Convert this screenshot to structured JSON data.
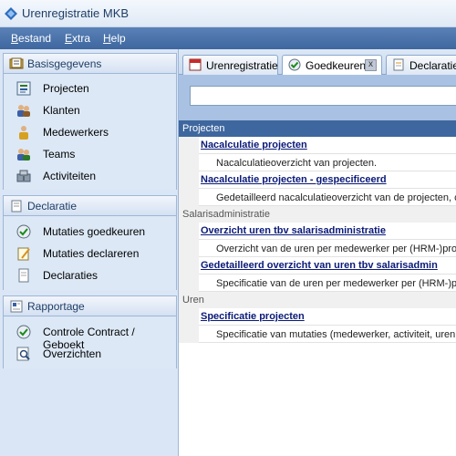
{
  "window": {
    "title": "Urenregistratie MKB"
  },
  "menubar": {
    "items": [
      {
        "label": "Bestand",
        "underline": "B"
      },
      {
        "label": "Extra",
        "underline": "E"
      },
      {
        "label": "Help",
        "underline": "H"
      }
    ]
  },
  "sidebar": {
    "groups": [
      {
        "label": "Basisgegevens",
        "items": [
          {
            "label": "Projecten"
          },
          {
            "label": "Klanten"
          },
          {
            "label": "Medewerkers"
          },
          {
            "label": "Teams"
          },
          {
            "label": "Activiteiten"
          }
        ]
      },
      {
        "label": "Declaratie",
        "items": [
          {
            "label": "Mutaties goedkeuren"
          },
          {
            "label": "Mutaties declareren"
          },
          {
            "label": "Declaraties"
          }
        ]
      },
      {
        "label": "Rapportage",
        "items": [
          {
            "label": "Controle Contract / Geboekt"
          },
          {
            "label": "Overzichten"
          }
        ]
      }
    ]
  },
  "tabs": [
    {
      "label": "Urenregistratie"
    },
    {
      "label": "Goedkeuren",
      "close": "x"
    },
    {
      "label": "Declaratiev"
    }
  ],
  "search": {
    "value": ""
  },
  "results": {
    "sections": [
      {
        "header": "Projecten",
        "entries": [
          {
            "title": "Nacalculatie projecten",
            "description": "Nacalculatieoverzicht van projecten."
          },
          {
            "title": "Nacalculatie projecten - gespecificeerd",
            "description": "Gedetailleerd nacalculatieoverzicht van de projecten, c"
          }
        ]
      },
      {
        "header": "Salarisadministratie",
        "entries": [
          {
            "title": "Overzicht uren tbv salarisadministratie",
            "description": "Overzicht van de uren per medewerker per (HRM-)proj"
          },
          {
            "title": "Gedetailleerd overzicht van uren tbv salarisadmin",
            "description": "Specificatie van de uren per medewerker per (HRM-)pr"
          }
        ]
      },
      {
        "header": "Uren",
        "entries": [
          {
            "title": "Specificatie projecten",
            "description": "Specificatie van mutaties (medewerker, activiteit, uren"
          }
        ]
      }
    ]
  },
  "colors": {
    "menubar": "#4a72aa",
    "sidebar": "#dae6f5",
    "link": "#0a1a78",
    "section_header_active": "#3f679f"
  }
}
